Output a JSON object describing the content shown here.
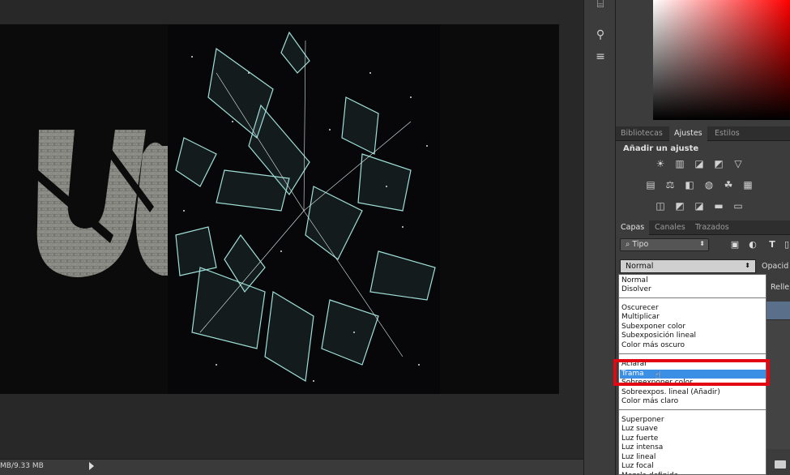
{
  "canvas": {
    "status_text": "MB/9.33 MB"
  },
  "tool_strip": {
    "icons": [
      "brush-preset-icon",
      "tool-preset-icon",
      "character-icon"
    ]
  },
  "panels": {
    "top_tabs": [
      {
        "label": "Bibliotecas",
        "active": false
      },
      {
        "label": "Ajustes",
        "active": true
      },
      {
        "label": "Estilos",
        "active": false
      }
    ],
    "adjustments_title": "Añadir un ajuste",
    "layer_tabs": [
      {
        "label": "Capas",
        "active": true
      },
      {
        "label": "Canales",
        "active": false
      },
      {
        "label": "Trazados",
        "active": false
      }
    ],
    "filter_value": "Tipo",
    "filter_icons": [
      "image-filter-icon",
      "adjustment-filter-icon",
      "type-filter-icon",
      "shape-filter-icon"
    ],
    "blend_mode_value": "Normal",
    "opacity_label": "Opacid",
    "fill_label": "Relle"
  },
  "dropdown": {
    "groups": [
      [
        "Normal",
        "Disolver"
      ],
      [
        "Oscurecer",
        "Multiplicar",
        "Subexponer color",
        "Subexposición lineal",
        "Color más oscuro"
      ],
      [
        "Aclarar",
        "Trama",
        "Sobreexponer color",
        "Sobreexpos. lineal (Añadir)",
        "Color más claro"
      ],
      [
        "Superponer",
        "Luz suave",
        "Luz fuerte",
        "Luz intensa",
        "Luz lineal",
        "Luz focal",
        "Mezcla definida"
      ]
    ],
    "highlighted": "Trama"
  },
  "colors": {
    "highlight": "#3b8fe5",
    "annotation_box": "#e30613"
  }
}
